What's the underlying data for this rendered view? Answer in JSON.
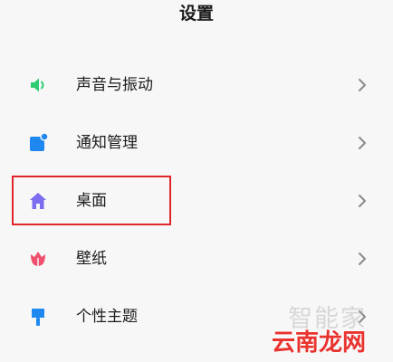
{
  "header": {
    "title": "设置"
  },
  "settings_items": [
    {
      "label": "声音与振动",
      "icon": "speaker-icon",
      "color": "#2ecc71"
    },
    {
      "label": "通知管理",
      "icon": "notification-icon",
      "color": "#1e88f0"
    },
    {
      "label": "桌面",
      "icon": "home-icon",
      "color": "#7b6cf0"
    },
    {
      "label": "壁纸",
      "icon": "tulip-icon",
      "color": "#f0506e"
    },
    {
      "label": "个性主题",
      "icon": "paint-brush-icon",
      "color": "#1e88f0"
    }
  ],
  "annotation": {
    "highlight_color": "#e0262b"
  },
  "watermark": {
    "top_text": "智能家",
    "bottom_text": "云南龙网"
  }
}
